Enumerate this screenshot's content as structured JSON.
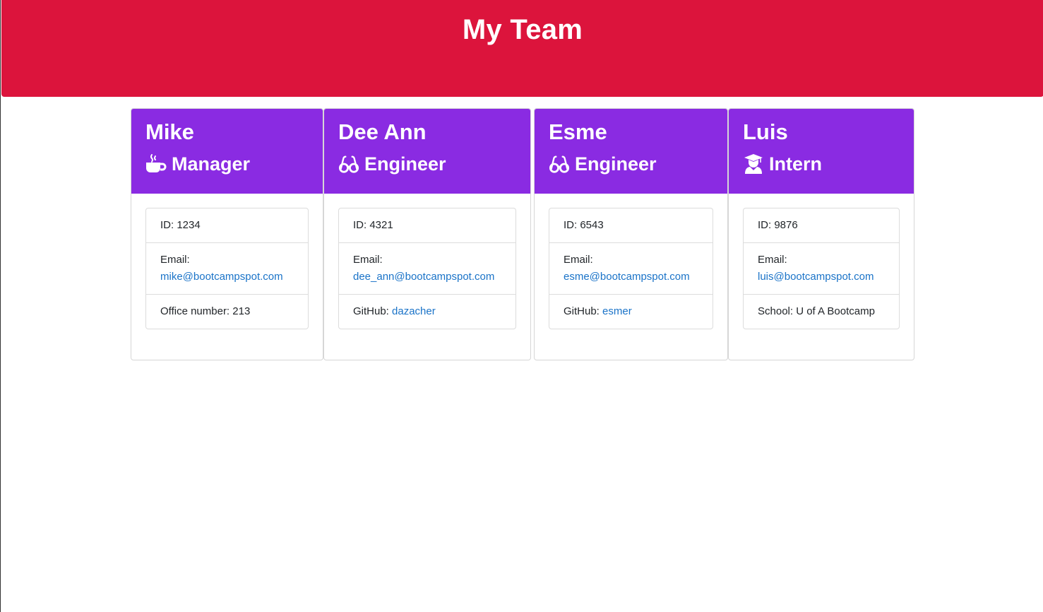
{
  "header": {
    "title": "My Team"
  },
  "cards": [
    {
      "name": "Mike",
      "role": "Manager",
      "role_icon": "coffee-icon",
      "id_label": "ID: 1234",
      "email_label": "Email:",
      "email": "mike@bootcampspot.com",
      "extra_label": "Office number: 213",
      "extra_link": ""
    },
    {
      "name": "Dee Ann",
      "role": "Engineer",
      "role_icon": "glasses-icon",
      "id_label": "ID: 4321",
      "email_label": "Email:",
      "email": "dee_ann@bootcampspot.com",
      "extra_label": "GitHub: ",
      "extra_link": "dazacher"
    },
    {
      "name": "Esme",
      "role": "Engineer",
      "role_icon": "glasses-icon",
      "id_label": "ID: 6543",
      "email_label": "Email:",
      "email": "esme@bootcampspot.com",
      "extra_label": "GitHub: ",
      "extra_link": "esmer"
    },
    {
      "name": "Luis",
      "role": "Intern",
      "role_icon": "graduate-icon",
      "id_label": "ID: 9876",
      "email_label": "Email:",
      "email": "luis@bootcampspot.com",
      "extra_label": "School: U of A Bootcamp",
      "extra_link": ""
    }
  ],
  "colors": {
    "header_bg": "#dc143c",
    "card_header_bg": "#8a2be2",
    "link": "#1a73c8"
  }
}
